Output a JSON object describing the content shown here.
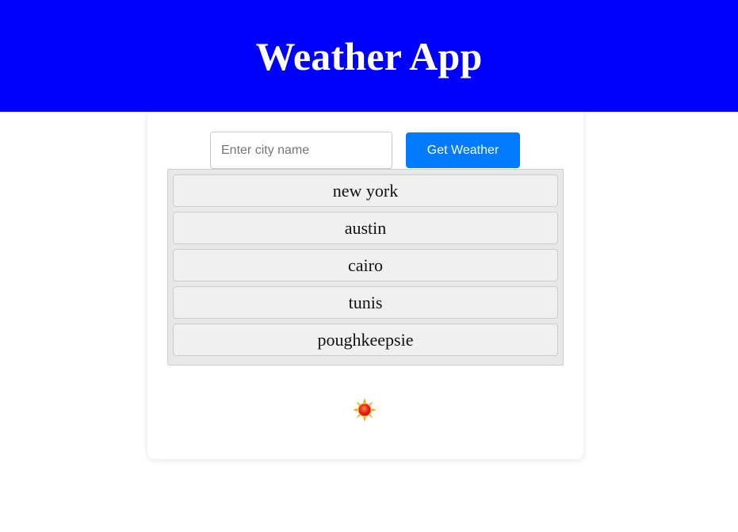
{
  "header": {
    "title": "Weather App",
    "background_color": "#0000ff"
  },
  "search": {
    "placeholder": "Enter city name",
    "value": "",
    "button_label": "Get Weather",
    "button_color": "#007bff"
  },
  "cities": [
    {
      "label": "new york"
    },
    {
      "label": "austin"
    },
    {
      "label": "cairo"
    },
    {
      "label": "tunis"
    },
    {
      "label": "poughkeepsie"
    }
  ],
  "weather": {
    "icon": "sun-icon"
  }
}
